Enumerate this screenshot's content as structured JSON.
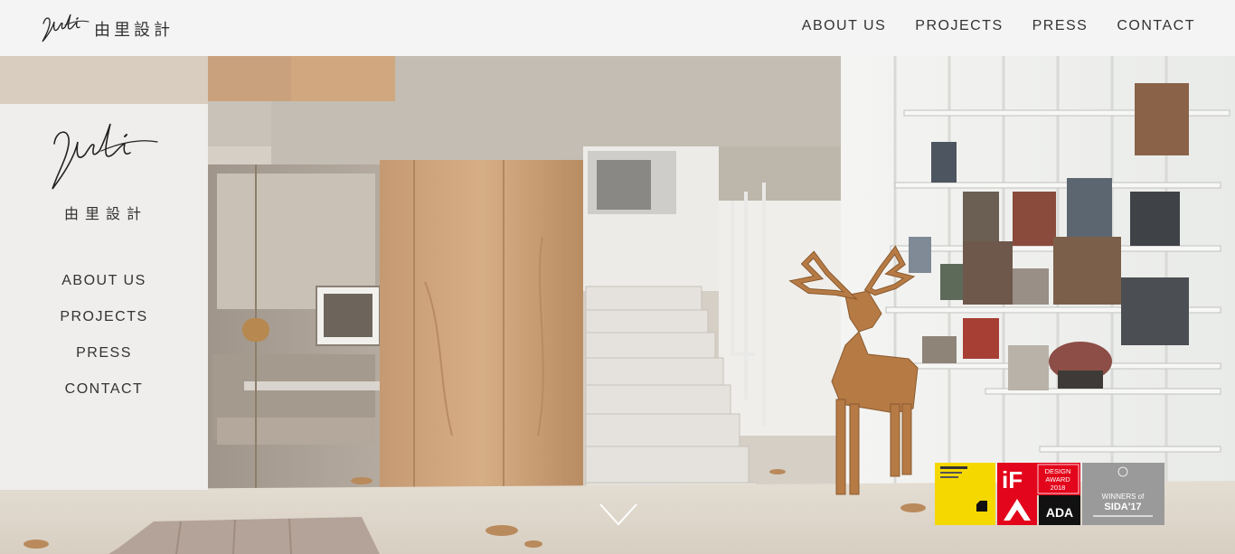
{
  "brand": {
    "script_logo": "Yuli",
    "name_cn": "由里設計"
  },
  "top_nav": {
    "items": [
      {
        "label": "ABOUT US"
      },
      {
        "label": "PROJECTS"
      },
      {
        "label": "PRESS"
      },
      {
        "label": "CONTACT"
      }
    ]
  },
  "side_nav": {
    "items": [
      {
        "label": "ABOUT US"
      },
      {
        "label": "PROJECTS"
      },
      {
        "label": "PRESS"
      },
      {
        "label": "CONTACT"
      }
    ]
  },
  "hero": {
    "image": "interior-photo-staircase-deer-sculpture-bookshelves"
  },
  "scroll_indicator": {
    "icon": "chevron-down-icon"
  },
  "awards": [
    {
      "name": "il-design-award-badge",
      "color": "#f5d800"
    },
    {
      "name": "if-design-award-2018-badge",
      "text": "DESIGN AWARD 2018",
      "color": "#e3051b"
    },
    {
      "name": "ada-award-badge",
      "text": "ADA",
      "color": "#e3051b"
    },
    {
      "name": "sida-17-badge",
      "text": "WINNERS of SIDA'17",
      "color": "#9a9a9a"
    }
  ]
}
